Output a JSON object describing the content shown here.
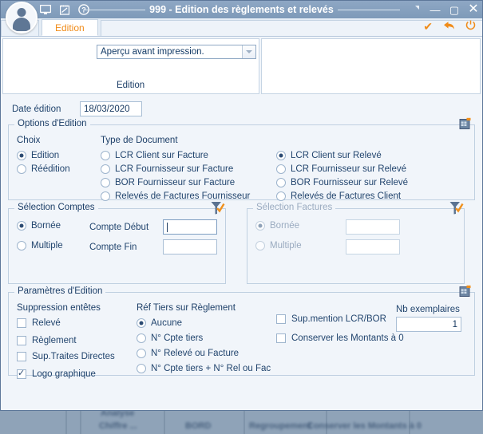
{
  "titlebar": {
    "title": "999 - Edition des règlements et relevés",
    "icons": [
      "user-avatar-icon",
      "monitor-icon",
      "notepad-icon",
      "help-icon"
    ],
    "buttons": {
      "restore_small": "restore-down-icon",
      "minimize": "—",
      "maximize": "▢",
      "close": "✕"
    }
  },
  "tabs": {
    "active_label": "Edition",
    "actions": {
      "validate": "✔",
      "back": "↰",
      "power": "⏻"
    }
  },
  "top_panes": {
    "output_mode": {
      "value": "Aperçu avant impression.",
      "placeholder": "Aperçu avant impression."
    },
    "caption": "Edition"
  },
  "date": {
    "label": "Date édition",
    "value": "18/03/2020"
  },
  "options_edition": {
    "legend": "Options d'Edition",
    "choix": {
      "title": "Choix",
      "items": [
        {
          "label": "Edition",
          "selected": true
        },
        {
          "label": "Réédition",
          "selected": false
        }
      ]
    },
    "type_document": {
      "title": "Type de Document",
      "col1": [
        {
          "label": "LCR Client sur Facture",
          "selected": false
        },
        {
          "label": "LCR Fournisseur sur Facture",
          "selected": false
        },
        {
          "label": "BOR Fournisseur sur Facture",
          "selected": false
        },
        {
          "label": "Relevés de Factures Fournisseur",
          "selected": false
        }
      ],
      "col2": [
        {
          "label": "LCR Client sur Relevé",
          "selected": true
        },
        {
          "label": "LCR Fournisseur sur Relevé",
          "selected": false
        },
        {
          "label": "BOR Fournisseur sur Relevé",
          "selected": false
        },
        {
          "label": "Relevés de Factures Client",
          "selected": false
        }
      ]
    }
  },
  "selection_comptes": {
    "legend": "Sélection Comptes",
    "modes": [
      {
        "label": "Bornée",
        "selected": true
      },
      {
        "label": "Multiple",
        "selected": false
      }
    ],
    "fields": [
      {
        "label": "Compte Début",
        "value": ""
      },
      {
        "label": "Compte Fin",
        "value": ""
      }
    ]
  },
  "selection_factures": {
    "legend": "Sélection Factures",
    "disabled": true,
    "modes": [
      {
        "label": "Bornée",
        "selected": true
      },
      {
        "label": "Multiple",
        "selected": false
      }
    ],
    "fields": [
      {
        "value": ""
      },
      {
        "value": ""
      }
    ]
  },
  "parametres_edition": {
    "legend": "Paramètres d'Edition",
    "suppression_entetes": {
      "title": "Suppression entêtes",
      "items": [
        {
          "label": "Relevé",
          "checked": false
        },
        {
          "label": "Règlement",
          "checked": false
        },
        {
          "label": "Sup.Traites Directes",
          "checked": false
        },
        {
          "label": "Logo graphique",
          "checked": true
        }
      ]
    },
    "ref_tiers": {
      "title": "Réf Tiers sur Règlement",
      "items": [
        {
          "label": "Aucune",
          "selected": true
        },
        {
          "label": "N° Cpte tiers",
          "selected": false
        },
        {
          "label": "N° Relevé ou Facture",
          "selected": false
        },
        {
          "label": "N° Cpte tiers + N° Rel ou Fac",
          "selected": false
        }
      ]
    },
    "extra_checks": [
      {
        "label": "Sup.mention LCR/BOR",
        "checked": false
      },
      {
        "label": "Conserver les Montants à 0",
        "checked": false
      }
    ],
    "nb_exemplaires": {
      "label": "Nb exemplaires",
      "value": "1"
    }
  },
  "background": {
    "blurred_labels": [
      "Analyse",
      "Chiffre ...",
      "BORD",
      "Regroupement",
      "Conserver les Montants à 0"
    ]
  },
  "colors": {
    "accent_orange": "#f08c1a",
    "titlebar_blue": "#8ea7c4",
    "panel_bg": "#f1f5fa",
    "text_blue": "#22456e",
    "border": "#c0d0e1",
    "desktop": "#8fa3b8"
  }
}
